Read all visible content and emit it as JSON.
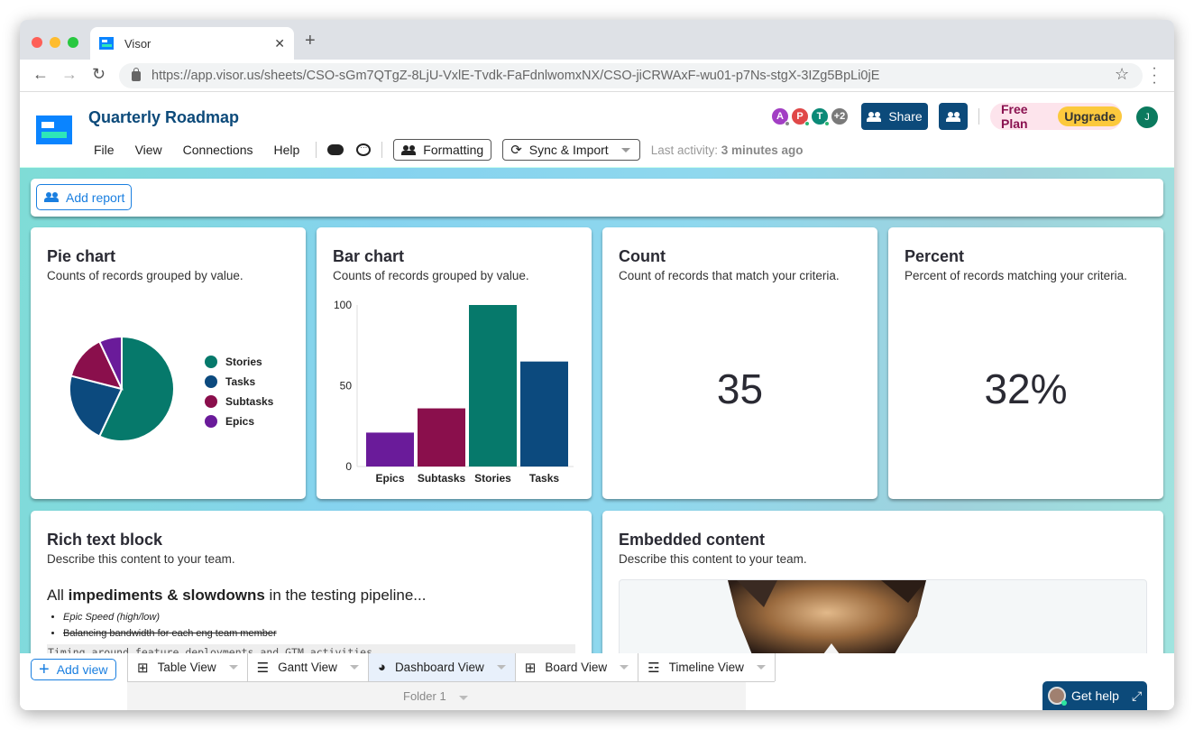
{
  "browser": {
    "tab_title": "Visor",
    "url": "https://app.visor.us/sheets/CSO-sGm7QTgZ-8LjU-VxlE-Tvdk-FaFdnlwomxNX/CSO-jiCRWAxF-wu01-p7Ns-stgX-3IZg5BpLi0jE"
  },
  "header": {
    "title": "Quarterly Roadmap",
    "menus": [
      "File",
      "View",
      "Connections",
      "Help"
    ],
    "formatting_label": "Formatting",
    "sync_label": "Sync & Import",
    "last_activity_label": "Last activity:",
    "last_activity_value": "3 minutes ago",
    "collaborators": [
      {
        "initial": "A",
        "color": "#a23ec4",
        "status": "#888"
      },
      {
        "initial": "P",
        "color": "#e04848",
        "status": "#2bb673"
      },
      {
        "initial": "T",
        "color": "#0b8a77",
        "status": "#2bb673"
      },
      {
        "initial": "+2",
        "color": "#7a7a7a",
        "status": null
      }
    ],
    "share_label": "Share",
    "plan_label": "Free Plan",
    "upgrade_label": "Upgrade",
    "user_initial": "J"
  },
  "toolbar": {
    "add_report_label": "Add report"
  },
  "cards": {
    "pie": {
      "title": "Pie chart",
      "subtitle": "Counts of records grouped by value."
    },
    "bar": {
      "title": "Bar chart",
      "subtitle": "Counts of records grouped by value."
    },
    "count": {
      "title": "Count",
      "subtitle": "Count of records that match your criteria.",
      "value": "35"
    },
    "percent": {
      "title": "Percent",
      "subtitle": "Percent of records matching your criteria.",
      "value": "32%"
    },
    "richtext": {
      "title": "Rich text block",
      "subtitle": "Describe this content to your team.",
      "line_pre": "All ",
      "line_bold": "impediments & slowdowns",
      "line_post": " in the testing pipeline...",
      "bullets": [
        "Epic Speed (high/low)",
        "Balancing bandwidth for each eng team member"
      ],
      "code": "Timing around feature deployments and GTM activities"
    },
    "embed": {
      "title": "Embedded content",
      "subtitle": "Describe this content to your team."
    }
  },
  "chart_data": [
    {
      "type": "pie",
      "title": "Pie chart",
      "categories": [
        "Stories",
        "Tasks",
        "Subtasks",
        "Epics"
      ],
      "values": [
        57,
        22,
        14,
        7
      ],
      "colors": [
        "#06796b",
        "#0c4a7e",
        "#8a0f4c",
        "#6a1b9a"
      ],
      "legend": "right"
    },
    {
      "type": "bar",
      "title": "Bar chart",
      "categories": [
        "Epics",
        "Subtasks",
        "Stories",
        "Tasks"
      ],
      "values": [
        21,
        36,
        100,
        65
      ],
      "colors": [
        "#6a1b9a",
        "#8a0f4c",
        "#06796b",
        "#0c4a7e"
      ],
      "yticks": [
        0,
        50,
        100
      ],
      "ylim": [
        0,
        100
      ],
      "grid": false
    }
  ],
  "views": {
    "add_view_label": "Add view",
    "tabs": [
      {
        "label": "Table View",
        "icon": "table-icon"
      },
      {
        "label": "Gantt View",
        "icon": "gantt-icon"
      },
      {
        "label": "Dashboard View",
        "icon": "pie-icon",
        "active": true
      },
      {
        "label": "Board View",
        "icon": "table-icon"
      },
      {
        "label": "Timeline View",
        "icon": "timeline-icon"
      }
    ],
    "folder_label": "Folder 1"
  },
  "help": {
    "label": "Get help"
  }
}
